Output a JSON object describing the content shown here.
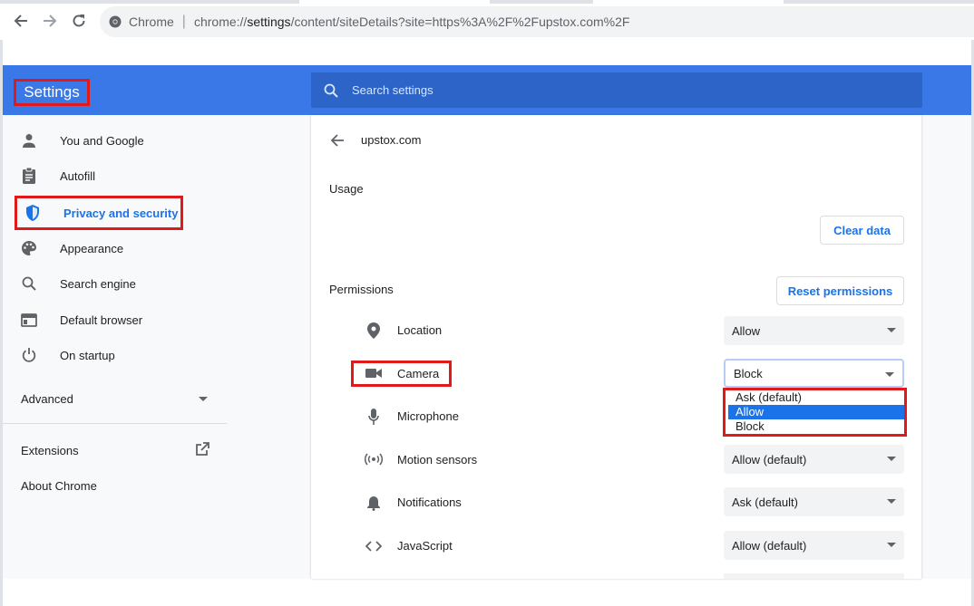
{
  "address": {
    "chrome_label": "Chrome",
    "separator": "|",
    "url_scheme": "chrome://",
    "url_host": "settings",
    "url_path": "/content/siteDetails?site=https%3A%2F%2Fupstox.com%2F"
  },
  "header": {
    "title": "Settings",
    "search_placeholder": "Search settings"
  },
  "sidebar": {
    "items": [
      {
        "label": "You and Google",
        "icon": "person-icon"
      },
      {
        "label": "Autofill",
        "icon": "clipboard-icon"
      },
      {
        "label": "Privacy and security",
        "icon": "shield-icon"
      },
      {
        "label": "Appearance",
        "icon": "palette-icon"
      },
      {
        "label": "Search engine",
        "icon": "search-icon"
      },
      {
        "label": "Default browser",
        "icon": "browser-icon"
      },
      {
        "label": "On startup",
        "icon": "power-icon"
      }
    ],
    "advanced_label": "Advanced",
    "extensions_label": "Extensions",
    "about_label": "About Chrome"
  },
  "site": {
    "title": "upstox.com",
    "usage_heading": "Usage",
    "clear_data_label": "Clear data",
    "permissions_heading": "Permissions",
    "reset_permissions_label": "Reset permissions"
  },
  "permissions": [
    {
      "label": "Location",
      "value": "Allow",
      "icon": "location-pin-icon"
    },
    {
      "label": "Camera",
      "value": "Block",
      "icon": "camera-icon"
    },
    {
      "label": "Microphone",
      "value": "",
      "icon": "microphone-icon"
    },
    {
      "label": "Motion sensors",
      "value": "Allow (default)",
      "icon": "motion-sensors-icon"
    },
    {
      "label": "Notifications",
      "value": "Ask (default)",
      "icon": "bell-icon"
    },
    {
      "label": "JavaScript",
      "value": "Allow (default)",
      "icon": "code-icon"
    }
  ],
  "camera_dropdown": {
    "options": [
      "Ask (default)",
      "Allow",
      "Block"
    ],
    "highlighted": "Allow"
  },
  "colors": {
    "header_blue": "#3b78e7",
    "accent": "#1a73e8",
    "highlight_red": "#e01a1a"
  }
}
